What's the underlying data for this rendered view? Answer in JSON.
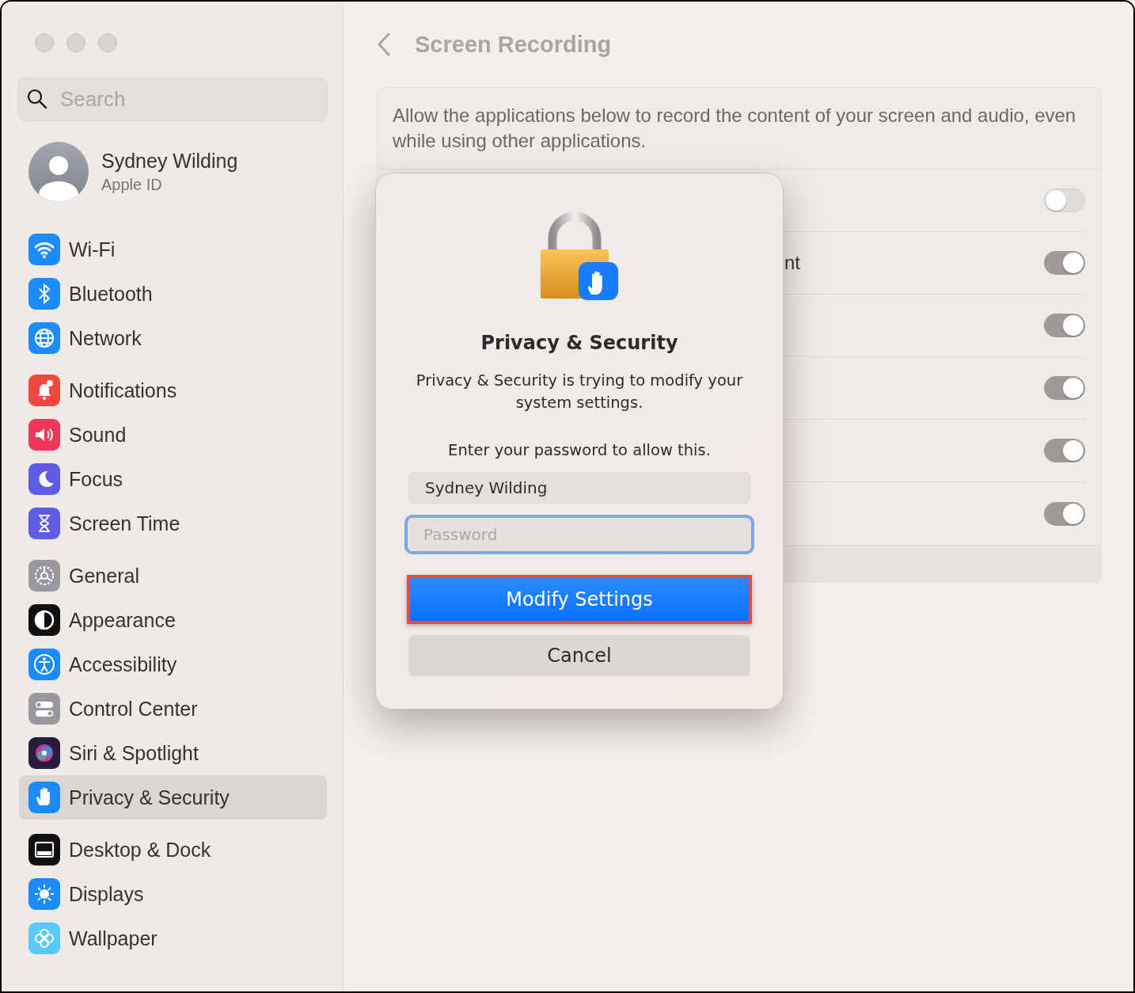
{
  "sidebar": {
    "search": {
      "placeholder": "Search"
    },
    "account": {
      "name": "Sydney Wilding",
      "subtitle": "Apple ID"
    },
    "groups": [
      [
        {
          "label": "Wi-Fi",
          "kind": "wifi",
          "selected": false
        },
        {
          "label": "Bluetooth",
          "kind": "bluetooth",
          "selected": false
        },
        {
          "label": "Network",
          "kind": "network",
          "selected": false
        }
      ],
      [
        {
          "label": "Notifications",
          "kind": "notifications",
          "selected": false
        },
        {
          "label": "Sound",
          "kind": "sound",
          "selected": false
        },
        {
          "label": "Focus",
          "kind": "focus",
          "selected": false
        },
        {
          "label": "Screen Time",
          "kind": "screentime",
          "selected": false
        }
      ],
      [
        {
          "label": "General",
          "kind": "general",
          "selected": false
        },
        {
          "label": "Appearance",
          "kind": "appearance",
          "selected": false
        },
        {
          "label": "Accessibility",
          "kind": "accessibility",
          "selected": false
        },
        {
          "label": "Control Center",
          "kind": "controlcenter",
          "selected": false
        },
        {
          "label": "Siri & Spotlight",
          "kind": "siri",
          "selected": false
        },
        {
          "label": "Privacy & Security",
          "kind": "privacy",
          "selected": true
        }
      ],
      [
        {
          "label": "Desktop & Dock",
          "kind": "dock",
          "selected": false
        },
        {
          "label": "Displays",
          "kind": "displays",
          "selected": false
        },
        {
          "label": "Wallpaper",
          "kind": "wallpaper",
          "selected": false
        }
      ]
    ]
  },
  "pane": {
    "title": "Screen Recording",
    "description": "Allow the applications below to record the content of your screen and audio, even while using other applications.",
    "rows": [
      {
        "on": false
      },
      {
        "label": "nt",
        "on": true
      },
      {
        "on": true
      },
      {
        "on": true
      },
      {
        "on": true
      },
      {
        "on": true
      }
    ]
  },
  "dialog": {
    "title": "Privacy & Security",
    "message": "Privacy & Security is trying to modify your system settings.",
    "prompt": "Enter your password to allow this.",
    "username": "Sydney Wilding",
    "password": {
      "placeholder": "Password",
      "focused": true
    },
    "buttons": [
      {
        "label": "Modify Settings",
        "kind": "primary",
        "highlighted": true
      },
      {
        "label": "Cancel",
        "kind": "secondary",
        "highlighted": false
      }
    ]
  }
}
